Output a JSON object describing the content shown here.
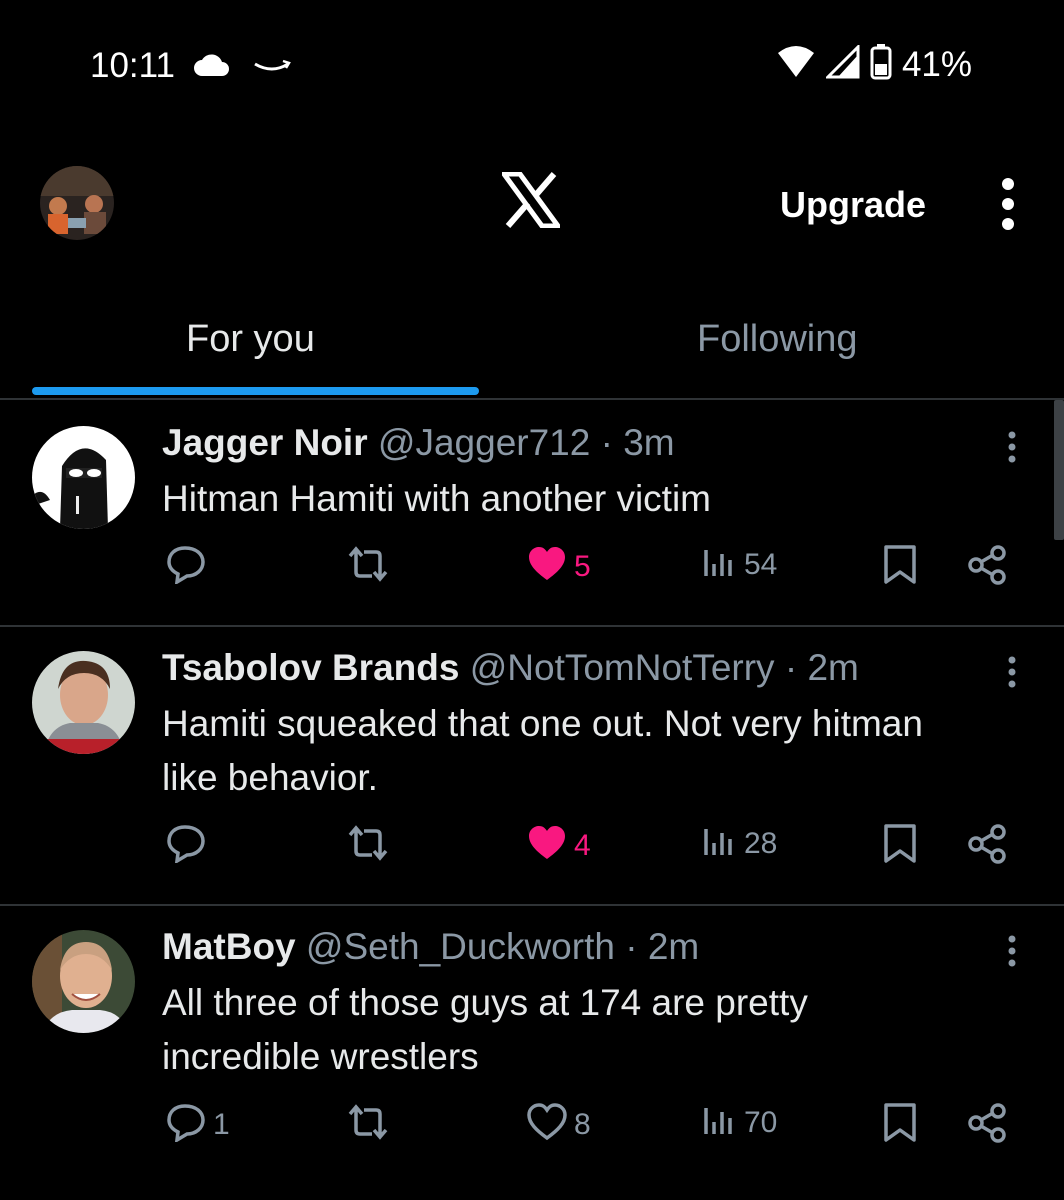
{
  "status_bar": {
    "time": "10:11",
    "battery": "41%"
  },
  "header": {
    "logo": "X",
    "upgrade_label": "Upgrade"
  },
  "tabs": [
    {
      "label": "For you",
      "active": true
    },
    {
      "label": "Following",
      "active": false
    }
  ],
  "colors": {
    "accent": "#1d9bf0",
    "like": "#f91880",
    "muted": "#8b98a5",
    "background": "#000000"
  },
  "tweets": [
    {
      "name": "Jagger Noir",
      "handle": "@Jagger712",
      "time": "· 3m",
      "text": "Hitman Hamiti with another victim",
      "replies": "",
      "retweets": "",
      "likes": "5",
      "liked": true,
      "views": "54"
    },
    {
      "name": "Tsabolov Brands",
      "handle": "@NotTomNotTerry",
      "time": "· 2m",
      "text": "Hamiti squeaked that one out. Not very hitman like behavior.",
      "replies": "",
      "retweets": "",
      "likes": "4",
      "liked": true,
      "views": "28"
    },
    {
      "name": "MatBoy",
      "handle": "@Seth_Duckworth",
      "time": "· 2m",
      "text": "All three of those guys at 174 are pretty incredible wrestlers",
      "replies": "1",
      "retweets": "",
      "likes": "8",
      "liked": false,
      "views": "70"
    }
  ]
}
